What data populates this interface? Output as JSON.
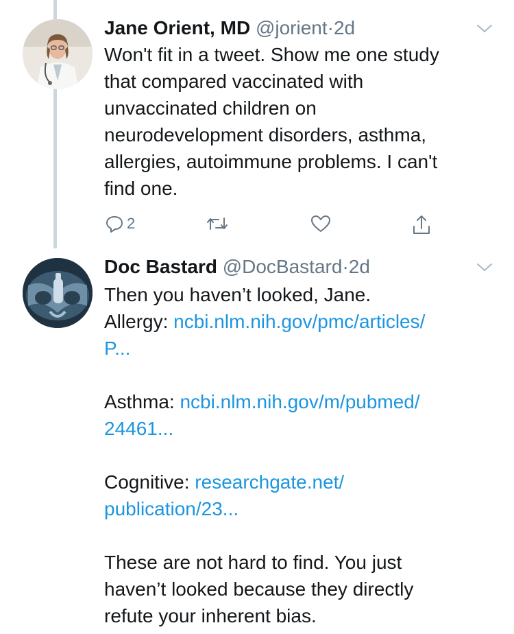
{
  "tweets": [
    {
      "name": "Jane Orient, MD",
      "handle": "@jorient",
      "separator": "·",
      "time": "2d",
      "text_lines": [
        "Won't fit in a tweet. Show me one study",
        "that compared vaccinated with",
        "unvaccinated children on",
        "neurodevelopment disorders, asthma,",
        "allergies, autoimmune problems. I can't",
        "find one."
      ],
      "reply_count": "2",
      "icons": {
        "avatar": "doctor-photo-avatar",
        "reply": "reply-icon",
        "retweet": "retweet-icon",
        "like": "heart-icon",
        "share": "share-icon",
        "menu": "chevron-down-icon"
      }
    },
    {
      "name": "Doc Bastard",
      "handle": "@DocBastard",
      "separator": "·",
      "time": "2d",
      "line1": "Then you haven’t looked, Jane.",
      "allergy_label": "Allergy:",
      "allergy_link_1": "ncbi.nlm.nih.gov/pmc/articles/",
      "allergy_link_2": "P...",
      "asthma_label": "Asthma:",
      "asthma_link_1": "ncbi.nlm.nih.gov/m/pubmed/",
      "asthma_link_2": "24461...",
      "cognitive_label": "Cognitive:",
      "cognitive_link_1": "researchgate.net/",
      "cognitive_link_2": "publication/23...",
      "closing_lines": [
        "These are not hard to find. You just",
        "haven’t looked because they directly",
        "refute your inherent bias."
      ],
      "icons": {
        "avatar": "xray-avatar",
        "menu": "chevron-down-icon"
      }
    }
  ],
  "colors": {
    "text": "#14171a",
    "secondary": "#657786",
    "link": "#1b95e0",
    "thread_line": "#ccd6dd"
  }
}
